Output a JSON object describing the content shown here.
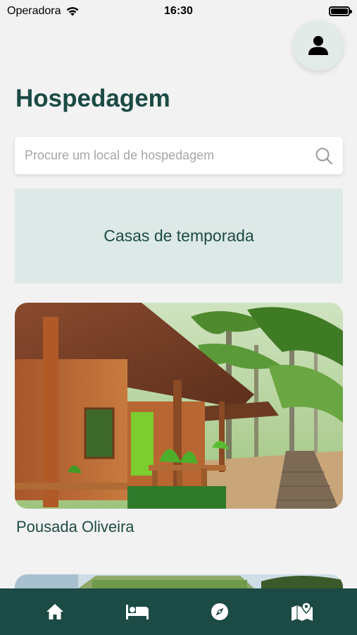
{
  "status_bar": {
    "carrier": "Operadora",
    "time": "16:30"
  },
  "page": {
    "title": "Hospedagem"
  },
  "search": {
    "placeholder": "Procure um local de hospedagem"
  },
  "categories": [
    {
      "label": "Casas de temporada"
    }
  ],
  "listings": [
    {
      "name": "Pousada Oliveira",
      "image": "wooden-cabin-photo"
    },
    {
      "name": "",
      "image": "green-roof-house-photo"
    }
  ],
  "tab_bar": {
    "tabs": [
      {
        "icon": "home-icon",
        "active": false
      },
      {
        "icon": "bed-icon",
        "active": true
      },
      {
        "icon": "compass-icon",
        "active": false
      },
      {
        "icon": "map-icon",
        "active": false
      }
    ]
  },
  "colors": {
    "primary": "#1c4a44",
    "category_bg": "#dde9e6",
    "background": "#f2f2f2"
  }
}
